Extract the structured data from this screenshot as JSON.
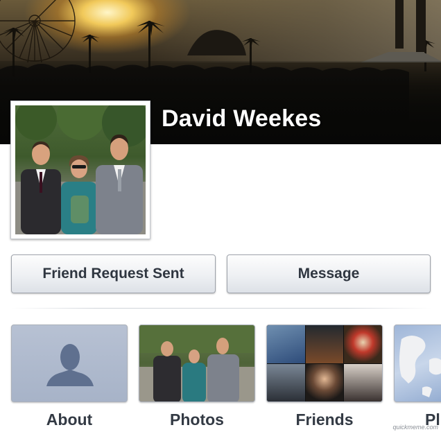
{
  "profile": {
    "name": "David Weekes"
  },
  "actions": {
    "friend_request_label": "Friend Request Sent",
    "message_label": "Message"
  },
  "tiles": [
    {
      "label": "About",
      "icon": "person-silhouette-icon"
    },
    {
      "label": "Photos"
    },
    {
      "label": "Friends"
    },
    {
      "label": "Pl"
    }
  ],
  "watermark": "quickmeme.com",
  "colors": {
    "button_text": "#2f3640",
    "tile_label": "#333a44",
    "about_tile_bg": "#b1bccf",
    "silhouette": "#5f708f"
  }
}
